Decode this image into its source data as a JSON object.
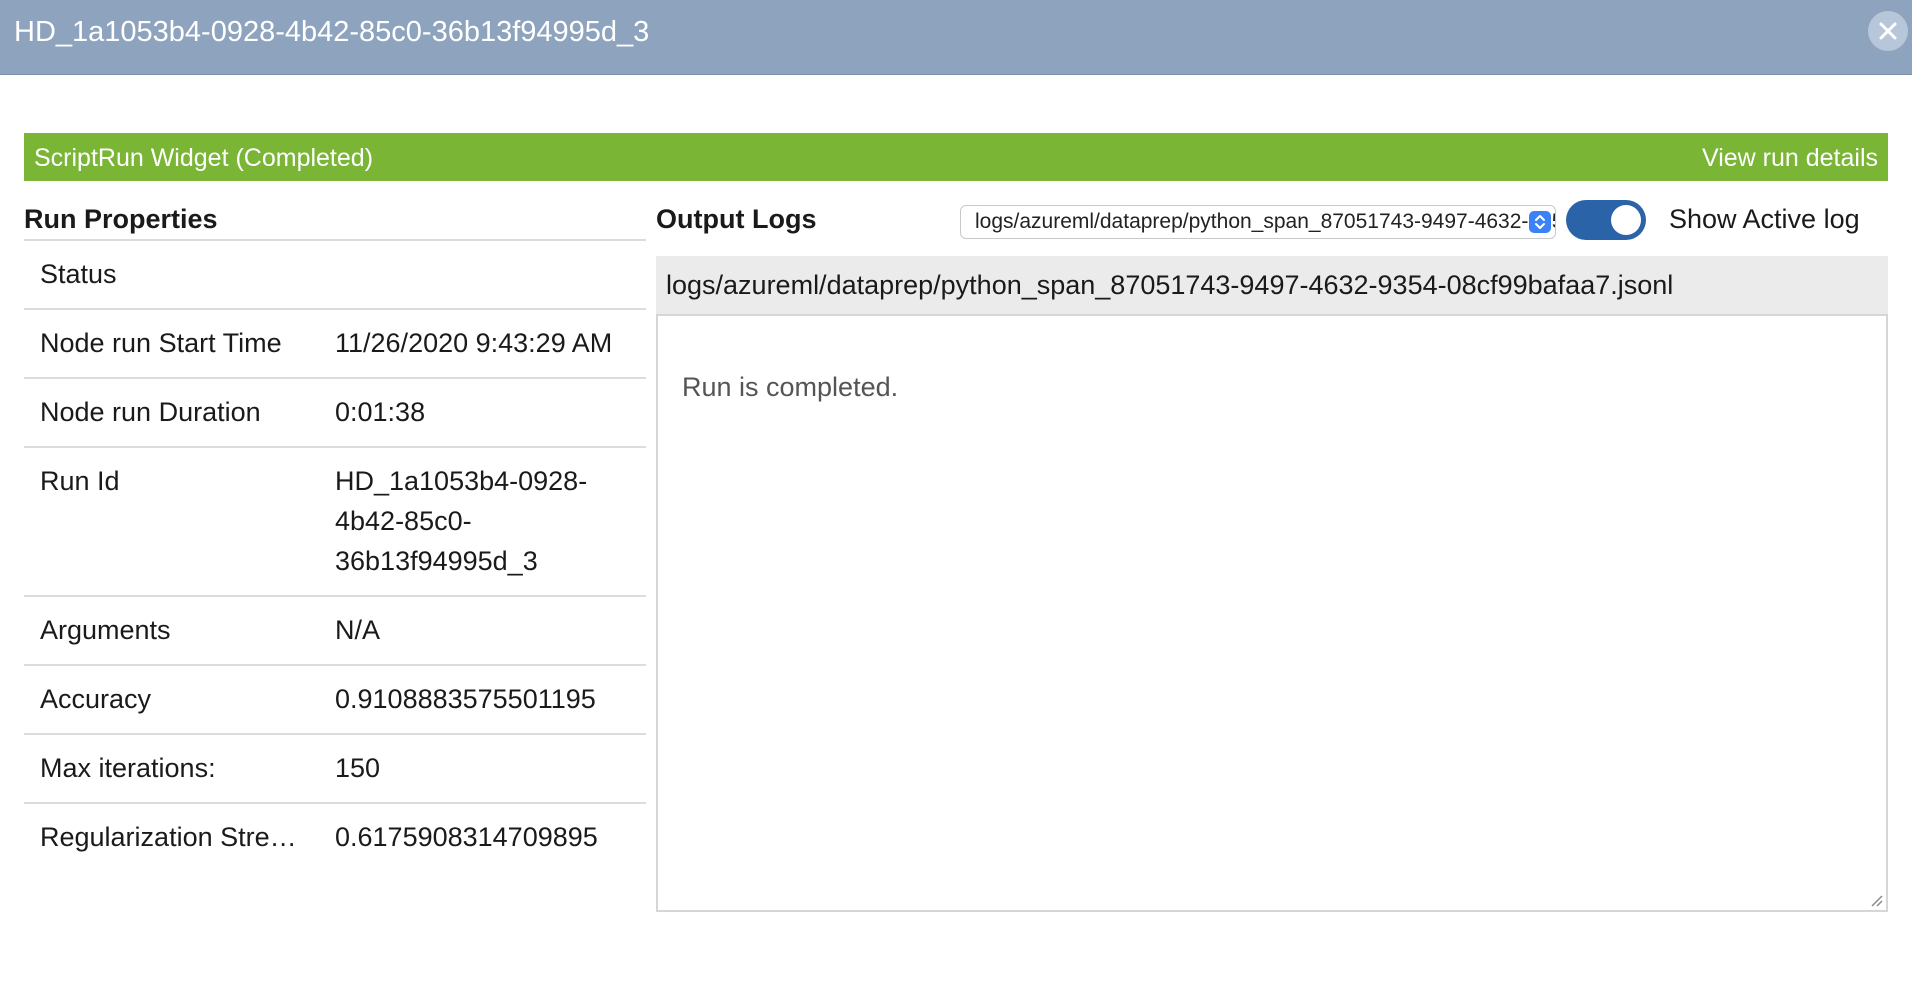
{
  "window": {
    "title": "HD_1a1053b4-0928-4b42-85c0-36b13f94995d_3",
    "close_icon": "close-icon"
  },
  "widget": {
    "title": "ScriptRun Widget (Completed)",
    "view_details_label": "View run details",
    "status_color": "#7ab536"
  },
  "run_properties": {
    "heading": "Run Properties",
    "rows": [
      {
        "key": "Status",
        "value": ""
      },
      {
        "key": "Node run Start Time",
        "value": "11/26/2020 9:43:29 AM"
      },
      {
        "key": "Node run Duration",
        "value": "0:01:38"
      },
      {
        "key": "Run Id",
        "value": "HD_1a1053b4-0928-4b42-85c0-36b13f94995d_3"
      },
      {
        "key": "Arguments",
        "value": "N/A"
      },
      {
        "key": "Accuracy",
        "value": "0.9108883575501195"
      },
      {
        "key": "Max iterations:",
        "value": "150"
      },
      {
        "key": "Regularization Stre…",
        "value": "0.6175908314709895"
      }
    ]
  },
  "output_logs": {
    "heading": "Output Logs",
    "selected_log": "logs/azureml/dataprep/python_span_87051743-9497-4632-9354-08cf99bafaa7.jsonl",
    "show_active_log_label": "Show Active log",
    "show_active_log_enabled": true,
    "log_path": "logs/azureml/dataprep/python_span_87051743-9497-4632-9354-08cf99bafaa7.jsonl",
    "log_content": "Run is completed."
  }
}
